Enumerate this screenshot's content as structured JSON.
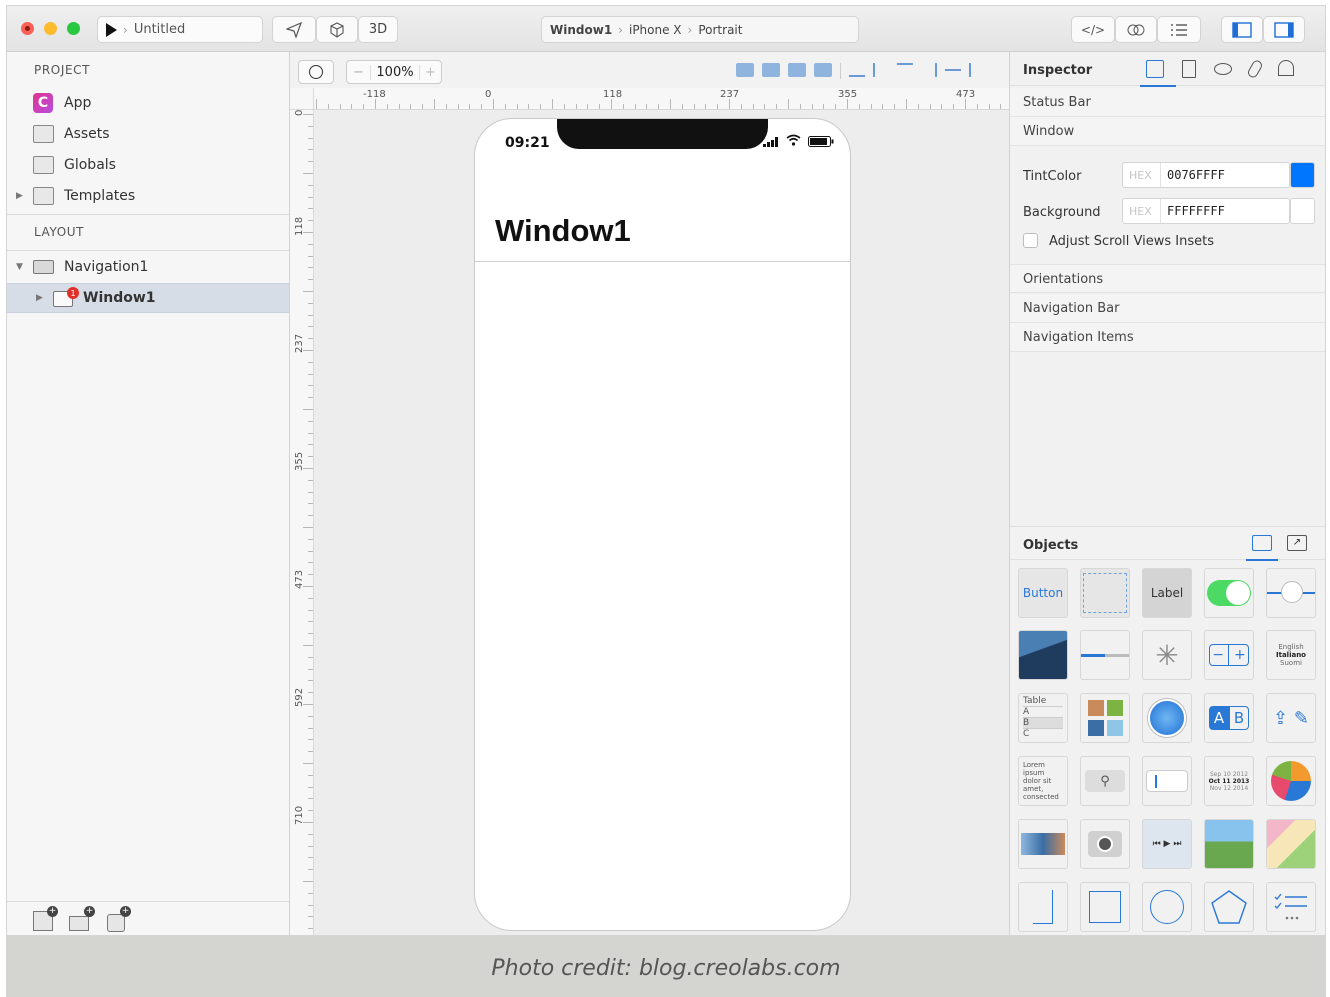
{
  "toolbar": {
    "document_name": "Untitled",
    "btn_3d": "3D",
    "breadcrumb": [
      "Window1",
      "iPhone X",
      "Portrait"
    ]
  },
  "project": {
    "header": "PROJECT",
    "items": [
      {
        "label": "App",
        "icon": "app-icon"
      },
      {
        "label": "Assets",
        "icon": "folder-assets-icon"
      },
      {
        "label": "Globals",
        "icon": "folder-globals-icon"
      },
      {
        "label": "Templates",
        "icon": "folder-templates-icon"
      }
    ]
  },
  "layout": {
    "header": "LAYOUT",
    "items": [
      {
        "label": "Navigation1",
        "icon": "navigation-icon"
      },
      {
        "label": "Window1",
        "icon": "window-icon",
        "badge": "1"
      }
    ]
  },
  "canvas": {
    "zoom": "100%",
    "ruler_h": [
      "-118",
      "0",
      "118",
      "237",
      "355",
      "473"
    ],
    "ruler_v": [
      "0",
      "118",
      "237",
      "355",
      "473",
      "592",
      "710"
    ],
    "phone": {
      "time": "09:21",
      "title": "Window1"
    }
  },
  "inspector": {
    "header": "Inspector",
    "sections": [
      "Status Bar",
      "Window"
    ],
    "tint_label": "TintColor",
    "tint_tag": "HEX",
    "tint_value": "0076FFFF",
    "tint_color": "#0076FF",
    "bg_label": "Background",
    "bg_tag": "HEX",
    "bg_value": "FFFFFFFF",
    "bg_color": "#FFFFFF",
    "adjust_label": "Adjust Scroll Views Insets",
    "more_sections": [
      "Orientations",
      "Navigation Bar",
      "Navigation Items"
    ]
  },
  "objects": {
    "header": "Objects",
    "button_label": "Button",
    "label_label": "Label",
    "table_label": "Table",
    "table_rows": [
      "A",
      "B",
      "C"
    ],
    "text_lines": [
      "Lorem",
      "ipsum",
      "dolor sit",
      "amet,",
      "consected"
    ],
    "segment_labels": [
      "A",
      "B"
    ],
    "picker_items": [
      "English",
      "Italiano",
      "Suomi"
    ],
    "date_items": [
      "Sep 10 2012",
      "Oct 11 2013",
      "Nov 12 2014"
    ]
  },
  "caption": "Photo credit: blog.creolabs.com"
}
